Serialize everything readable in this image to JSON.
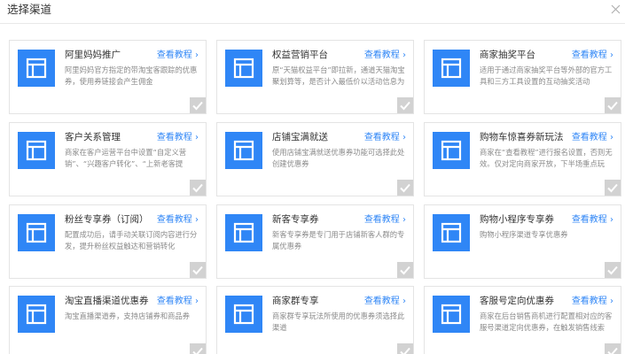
{
  "dialog": {
    "title": "选择渠道",
    "close_icon": "close-icon"
  },
  "colors": {
    "accent": "#2f86f6",
    "check_bg": "#d2d2d2"
  },
  "cards": [
    {
      "title": "阿里妈妈推广",
      "link": "查看教程",
      "desc": "阿里妈妈官方指定的带淘宝客跟踪的优惠券，使用券链接会产生佣金"
    },
    {
      "title": "权益营销平台",
      "link": "查看教程",
      "desc": "原“天猫权益平台”即拉新，通道天猫淘宝聚划算等，是否计入最低价以活动信息为准"
    },
    {
      "title": "商家抽奖平台",
      "link": "查看教程",
      "desc": "适用于通过商家抽奖平台等外部的官方工具和三方工具设置的互动抽奖活动"
    },
    {
      "title": "客户关系管理",
      "link": "查看教程",
      "desc": "商家在客户运营平台中设置“自定义营销”、“兴趣客户转化”、“上新老客提醒”和“优惠券"
    },
    {
      "title": "店铺宝满就送",
      "link": "查看教程",
      "desc": "使用店铺宝满就送优惠券功能可选择此处创建优惠券"
    },
    {
      "title": "购物车惊喜券新玩法",
      "link": "查看教程",
      "desc": "商家在“查看教程”进行报名设置，否则无效。仅对定向商家开放，下半场重点玩法。"
    },
    {
      "title": "粉丝专享券（订阅）",
      "link": "查看教程",
      "desc": "配置成功后，请手动关联订阅内容进行分发，提升粉丝权益触达和营销转化"
    },
    {
      "title": "新客专享券",
      "link": "查看教程",
      "desc": "新客专享券是专门用于店铺新客人群的专属优惠券"
    },
    {
      "title": "购物小程序专享券",
      "link": "查看教程",
      "desc": "购物小程序渠道专享优惠券"
    },
    {
      "title": "淘宝直播渠道优惠券",
      "link": "查看教程",
      "desc": "淘宝直播渠道券，支持店铺券和商品券"
    },
    {
      "title": "商家群专享",
      "link": "查看教程",
      "desc": "商家群专享玩法所使用的优惠券须选择此渠道"
    },
    {
      "title": "客服号定向优惠券",
      "link": "查看教程",
      "desc": "商家在后台销售商机进行配置相对应的客服号渠道定向优惠券，在触发销售线索"
    }
  ]
}
